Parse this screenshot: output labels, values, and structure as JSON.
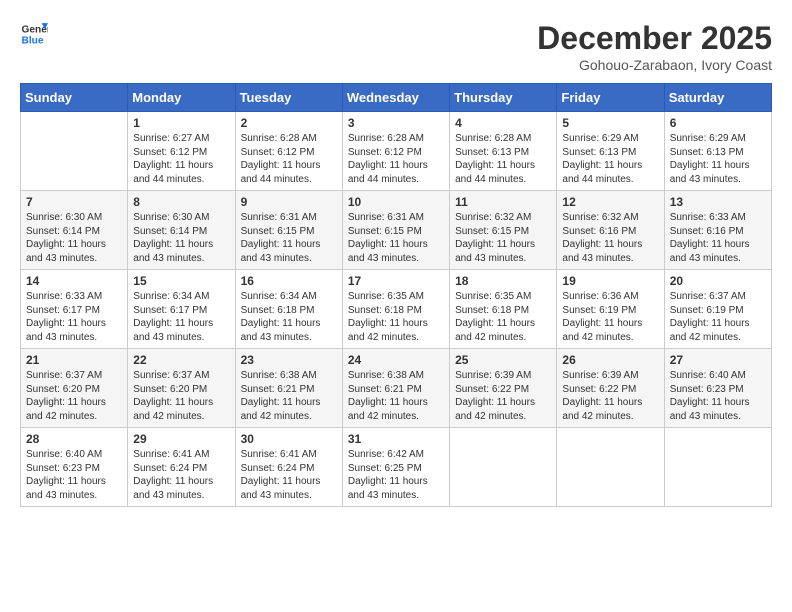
{
  "logo": {
    "line1": "General",
    "line2": "Blue"
  },
  "title": "December 2025",
  "subtitle": "Gohouo-Zarabaon, Ivory Coast",
  "days_of_week": [
    "Sunday",
    "Monday",
    "Tuesday",
    "Wednesday",
    "Thursday",
    "Friday",
    "Saturday"
  ],
  "weeks": [
    [
      {
        "day": "",
        "info": ""
      },
      {
        "day": "1",
        "info": "Sunrise: 6:27 AM\nSunset: 6:12 PM\nDaylight: 11 hours\nand 44 minutes."
      },
      {
        "day": "2",
        "info": "Sunrise: 6:28 AM\nSunset: 6:12 PM\nDaylight: 11 hours\nand 44 minutes."
      },
      {
        "day": "3",
        "info": "Sunrise: 6:28 AM\nSunset: 6:12 PM\nDaylight: 11 hours\nand 44 minutes."
      },
      {
        "day": "4",
        "info": "Sunrise: 6:28 AM\nSunset: 6:13 PM\nDaylight: 11 hours\nand 44 minutes."
      },
      {
        "day": "5",
        "info": "Sunrise: 6:29 AM\nSunset: 6:13 PM\nDaylight: 11 hours\nand 44 minutes."
      },
      {
        "day": "6",
        "info": "Sunrise: 6:29 AM\nSunset: 6:13 PM\nDaylight: 11 hours\nand 43 minutes."
      }
    ],
    [
      {
        "day": "7",
        "info": "Sunrise: 6:30 AM\nSunset: 6:14 PM\nDaylight: 11 hours\nand 43 minutes."
      },
      {
        "day": "8",
        "info": "Sunrise: 6:30 AM\nSunset: 6:14 PM\nDaylight: 11 hours\nand 43 minutes."
      },
      {
        "day": "9",
        "info": "Sunrise: 6:31 AM\nSunset: 6:15 PM\nDaylight: 11 hours\nand 43 minutes."
      },
      {
        "day": "10",
        "info": "Sunrise: 6:31 AM\nSunset: 6:15 PM\nDaylight: 11 hours\nand 43 minutes."
      },
      {
        "day": "11",
        "info": "Sunrise: 6:32 AM\nSunset: 6:15 PM\nDaylight: 11 hours\nand 43 minutes."
      },
      {
        "day": "12",
        "info": "Sunrise: 6:32 AM\nSunset: 6:16 PM\nDaylight: 11 hours\nand 43 minutes."
      },
      {
        "day": "13",
        "info": "Sunrise: 6:33 AM\nSunset: 6:16 PM\nDaylight: 11 hours\nand 43 minutes."
      }
    ],
    [
      {
        "day": "14",
        "info": "Sunrise: 6:33 AM\nSunset: 6:17 PM\nDaylight: 11 hours\nand 43 minutes."
      },
      {
        "day": "15",
        "info": "Sunrise: 6:34 AM\nSunset: 6:17 PM\nDaylight: 11 hours\nand 43 minutes."
      },
      {
        "day": "16",
        "info": "Sunrise: 6:34 AM\nSunset: 6:18 PM\nDaylight: 11 hours\nand 43 minutes."
      },
      {
        "day": "17",
        "info": "Sunrise: 6:35 AM\nSunset: 6:18 PM\nDaylight: 11 hours\nand 42 minutes."
      },
      {
        "day": "18",
        "info": "Sunrise: 6:35 AM\nSunset: 6:18 PM\nDaylight: 11 hours\nand 42 minutes."
      },
      {
        "day": "19",
        "info": "Sunrise: 6:36 AM\nSunset: 6:19 PM\nDaylight: 11 hours\nand 42 minutes."
      },
      {
        "day": "20",
        "info": "Sunrise: 6:37 AM\nSunset: 6:19 PM\nDaylight: 11 hours\nand 42 minutes."
      }
    ],
    [
      {
        "day": "21",
        "info": "Sunrise: 6:37 AM\nSunset: 6:20 PM\nDaylight: 11 hours\nand 42 minutes."
      },
      {
        "day": "22",
        "info": "Sunrise: 6:37 AM\nSunset: 6:20 PM\nDaylight: 11 hours\nand 42 minutes."
      },
      {
        "day": "23",
        "info": "Sunrise: 6:38 AM\nSunset: 6:21 PM\nDaylight: 11 hours\nand 42 minutes."
      },
      {
        "day": "24",
        "info": "Sunrise: 6:38 AM\nSunset: 6:21 PM\nDaylight: 11 hours\nand 42 minutes."
      },
      {
        "day": "25",
        "info": "Sunrise: 6:39 AM\nSunset: 6:22 PM\nDaylight: 11 hours\nand 42 minutes."
      },
      {
        "day": "26",
        "info": "Sunrise: 6:39 AM\nSunset: 6:22 PM\nDaylight: 11 hours\nand 42 minutes."
      },
      {
        "day": "27",
        "info": "Sunrise: 6:40 AM\nSunset: 6:23 PM\nDaylight: 11 hours\nand 43 minutes."
      }
    ],
    [
      {
        "day": "28",
        "info": "Sunrise: 6:40 AM\nSunset: 6:23 PM\nDaylight: 11 hours\nand 43 minutes."
      },
      {
        "day": "29",
        "info": "Sunrise: 6:41 AM\nSunset: 6:24 PM\nDaylight: 11 hours\nand 43 minutes."
      },
      {
        "day": "30",
        "info": "Sunrise: 6:41 AM\nSunset: 6:24 PM\nDaylight: 11 hours\nand 43 minutes."
      },
      {
        "day": "31",
        "info": "Sunrise: 6:42 AM\nSunset: 6:25 PM\nDaylight: 11 hours\nand 43 minutes."
      },
      {
        "day": "",
        "info": ""
      },
      {
        "day": "",
        "info": ""
      },
      {
        "day": "",
        "info": ""
      }
    ]
  ]
}
